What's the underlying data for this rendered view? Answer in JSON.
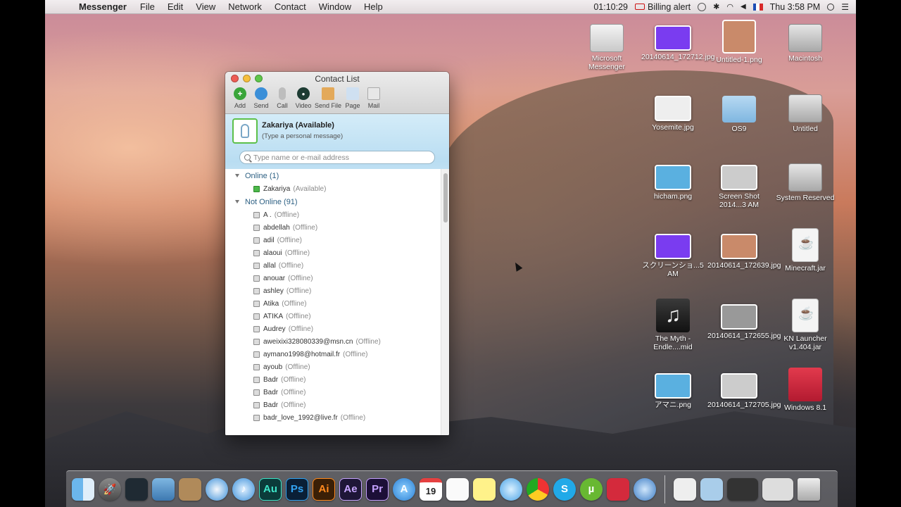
{
  "menubar": {
    "app_name": "Messenger",
    "menus": [
      "File",
      "Edit",
      "View",
      "Network",
      "Contact",
      "Window",
      "Help"
    ],
    "time_display": "01:10:29",
    "billing_alert": "Billing alert",
    "clock": "Thu 3:58 PM",
    "icons": [
      "apple-icon",
      "billing-card-icon",
      "time-machine-icon",
      "bluetooth-icon",
      "wifi-icon",
      "volume-icon",
      "flag-fr-icon",
      "spotlight-icon",
      "notification-center-icon"
    ]
  },
  "window": {
    "title": "Contact List",
    "toolbar": [
      {
        "label": "Add",
        "icon": "add-icon",
        "color": "#3aa53a"
      },
      {
        "label": "Send",
        "icon": "send-icon",
        "color": "#3b8fd8"
      },
      {
        "label": "Call",
        "icon": "microphone-icon",
        "color": "#8a8a8a"
      },
      {
        "label": "Video",
        "icon": "camera-icon",
        "color": "#1d3c33"
      },
      {
        "label": "Send File",
        "icon": "send-file-icon",
        "color": "#c67a2e"
      },
      {
        "label": "Page",
        "icon": "page-icon",
        "color": "#7aa6d4"
      },
      {
        "label": "Mail",
        "icon": "mail-icon",
        "color": "#9a9a9a"
      }
    ],
    "profile": {
      "name": "Zakariya (Available)",
      "message": "(Type a personal message)"
    },
    "search": {
      "placeholder": "Type name or e-mail address"
    },
    "groups": [
      {
        "label": "Online (1)",
        "contacts": [
          {
            "name": "Zakariya",
            "status": "(Available)",
            "online": true
          }
        ]
      },
      {
        "label": "Not Online (91)",
        "contacts": [
          {
            "name": "A .",
            "status": "(Offline)",
            "online": false
          },
          {
            "name": "abdellah",
            "status": "(Offline)",
            "online": false
          },
          {
            "name": "adil",
            "status": "(Offline)",
            "online": false
          },
          {
            "name": "alaoui",
            "status": "(Offline)",
            "online": false
          },
          {
            "name": "allal",
            "status": "(Offline)",
            "online": false
          },
          {
            "name": "anouar",
            "status": "(Offline)",
            "online": false
          },
          {
            "name": "ashley",
            "status": "(Offline)",
            "online": false
          },
          {
            "name": "Atika",
            "status": "(Offline)",
            "online": false
          },
          {
            "name": "ATIKA",
            "status": "(Offline)",
            "online": false
          },
          {
            "name": "Audrey",
            "status": "(Offline)",
            "online": false
          },
          {
            "name": "aweixixi328080339@msn.cn",
            "status": "(Offline)",
            "online": false
          },
          {
            "name": "aymano1998@hotmail.fr",
            "status": "(Offline)",
            "online": false
          },
          {
            "name": "ayoub",
            "status": "(Offline)",
            "online": false
          },
          {
            "name": "Badr",
            "status": "(Offline)",
            "online": false
          },
          {
            "name": "Badr",
            "status": "(Offline)",
            "online": false
          },
          {
            "name": "Badr",
            "status": "(Offline)",
            "online": false
          },
          {
            "name": "badr_love_1992@live.fr",
            "status": "(Offline)",
            "online": false
          }
        ]
      }
    ]
  },
  "desktop_icons": [
    {
      "label": "Microsoft Messenger",
      "icon": "drive-icon"
    },
    {
      "label": "20140614_172712.jpg",
      "icon": "image-thumbnail-icon"
    },
    {
      "label": "Untitled-1.png",
      "icon": "image-thumbnail-icon"
    },
    {
      "label": "Macintosh",
      "icon": "hard-drive-icon"
    },
    {
      "label": "Yosemite.jpg",
      "icon": "image-thumbnail-icon"
    },
    {
      "label": "OS9",
      "icon": "folder-icon"
    },
    {
      "label": "Untitled",
      "icon": "hard-drive-icon"
    },
    {
      "label": "hicham.png",
      "icon": "image-thumbnail-icon"
    },
    {
      "label": "Screen Shot 2014...3 AM",
      "icon": "image-thumbnail-icon"
    },
    {
      "label": "System Reserved",
      "icon": "hard-drive-icon"
    },
    {
      "label": "スクリーンショ...5 AM",
      "icon": "image-thumbnail-icon"
    },
    {
      "label": "20140614_172639.jpg",
      "icon": "image-thumbnail-icon"
    },
    {
      "label": "Minecraft.jar",
      "icon": "jar-icon"
    },
    {
      "label": "The Myth - Endle....mid",
      "icon": "music-icon"
    },
    {
      "label": "20140614_172655.jpg",
      "icon": "image-thumbnail-icon"
    },
    {
      "label": "KN Launcher v1.404.jar",
      "icon": "jar-icon"
    },
    {
      "label": "アマニ.png",
      "icon": "image-thumbnail-icon"
    },
    {
      "label": "20140614_172705.jpg",
      "icon": "image-thumbnail-icon"
    },
    {
      "label": "Windows 8.1",
      "icon": "parallels-icon"
    }
  ],
  "dock": {
    "calendar_day": "19",
    "app_labels": {
      "au": "Au",
      "ps": "Ps",
      "ai": "Ai",
      "ae": "Ae",
      "pr": "Pr"
    },
    "items": [
      "finder-icon",
      "launchpad-icon",
      "mission-control-icon",
      "preview-icon",
      "contacts-icon",
      "safari-icon",
      "itunes-icon",
      "audition-icon",
      "photoshop-icon",
      "illustrator-icon",
      "after-effects-icon",
      "premiere-icon",
      "app-store-icon",
      "calendar-icon",
      "reminders-icon",
      "stickies-icon",
      "messages-icon",
      "chrome-icon",
      "skype-icon",
      "utorrent-icon",
      "parallels-icon",
      "network-icon",
      "documents-icon",
      "folder-icon",
      "downloads-icon",
      "trash-icon"
    ]
  }
}
